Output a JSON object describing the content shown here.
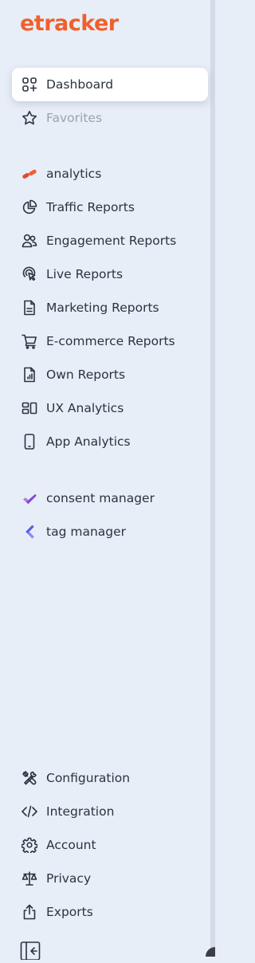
{
  "brand": {
    "logo_text": "etracker",
    "accent_color": "#f0602b"
  },
  "nav": {
    "dashboard": {
      "label": "Dashboard",
      "icon": "dashboard-icon",
      "active": true
    },
    "favorites": {
      "label": "Favorites",
      "icon": "star-icon"
    },
    "analytics": {
      "label": "analytics",
      "icon": "analytics-logo-icon"
    },
    "traffic_reports": {
      "label": "Traffic Reports",
      "icon": "pie-chart-icon"
    },
    "engagement_reports": {
      "label": "Engagement Reports",
      "icon": "users-icon"
    },
    "live_reports": {
      "label": "Live Reports",
      "icon": "live-pointer-icon"
    },
    "marketing_reports": {
      "label": "Marketing Reports",
      "icon": "document-icon"
    },
    "ecommerce_reports": {
      "label": "E-commerce Reports",
      "icon": "cart-icon"
    },
    "own_reports": {
      "label": "Own Reports",
      "icon": "report-file-icon"
    },
    "ux_analytics": {
      "label": "UX Analytics",
      "icon": "layout-icon"
    },
    "app_analytics": {
      "label": "App Analytics",
      "icon": "smartphone-icon"
    },
    "consent_manager": {
      "label": "consent manager",
      "icon": "consent-logo-icon"
    },
    "tag_manager": {
      "label": "tag manager",
      "icon": "tag-manager-logo-icon"
    }
  },
  "footer_nav": {
    "configuration": {
      "label": "Configuration",
      "icon": "tools-icon"
    },
    "integration": {
      "label": "Integration",
      "icon": "code-icon"
    },
    "account": {
      "label": "Account",
      "icon": "gear-icon"
    },
    "privacy": {
      "label": "Privacy",
      "icon": "scale-icon"
    },
    "exports": {
      "label": "Exports",
      "icon": "share-icon"
    },
    "collapse": {
      "icon": "collapse-sidebar-icon"
    }
  }
}
